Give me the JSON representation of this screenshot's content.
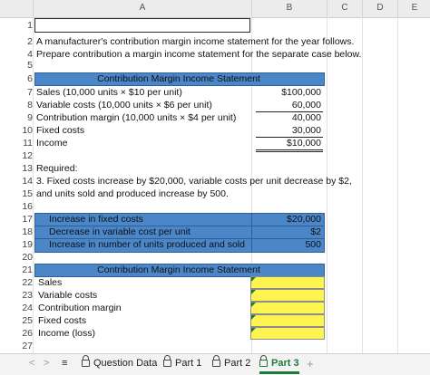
{
  "columns": {
    "a": "A",
    "b": "B",
    "c": "C",
    "d": "D",
    "e": "E"
  },
  "rows": [
    "1",
    "2",
    "4",
    "5",
    "6",
    "7",
    "8",
    "9",
    "10",
    "11",
    "12",
    "13",
    "14",
    "15",
    "16",
    "17",
    "18",
    "19",
    "20",
    "21",
    "22",
    "23",
    "24",
    "25",
    "26",
    "27"
  ],
  "intro": {
    "line1": "A manufacturer's contribution margin income statement for the year follows.",
    "line2": "Prepare contribution a margin income statement for the separate case below."
  },
  "statement1": {
    "title": "Contribution Margin Income Statement",
    "lines": [
      {
        "label": "Sales (10,000 units × $10 per unit)",
        "value": "$100,000"
      },
      {
        "label": "Variable costs (10,000 units × $6 per unit)",
        "value": "60,000"
      },
      {
        "label": "Contribution margin (10,000 units × $4 per unit)",
        "value": "40,000"
      },
      {
        "label": "Fixed costs",
        "value": "30,000"
      },
      {
        "label": "Income",
        "value": "$10,000"
      }
    ]
  },
  "required": {
    "heading": "Required:",
    "line1": "3. Fixed costs increase by $20,000, variable costs per unit decrease by $2,",
    "line2": "and units sold and produced increase by 500."
  },
  "changes": [
    {
      "label": "Increase in fixed costs",
      "value": "$20,000"
    },
    {
      "label": "Decrease in variable cost per unit",
      "value": "$2"
    },
    {
      "label": "Increase in number of units produced and sold",
      "value": "500"
    }
  ],
  "statement2": {
    "title": "Contribution Margin Income Statement",
    "lines": [
      "Sales",
      "Variable costs",
      "Contribution margin",
      "Fixed costs",
      "Income (loss)"
    ],
    "answers": [
      "",
      "",
      "",
      "",
      ""
    ]
  },
  "tabs": {
    "prev": "<",
    "next": ">",
    "menu": "≡",
    "items": [
      "Question Data",
      "Part 1",
      "Part 2",
      "Part 3"
    ],
    "add": "+"
  },
  "colors": {
    "header_blue": "#4a86c8",
    "input_yellow": "#fff44f",
    "active_tab": "#1f7a3a"
  }
}
